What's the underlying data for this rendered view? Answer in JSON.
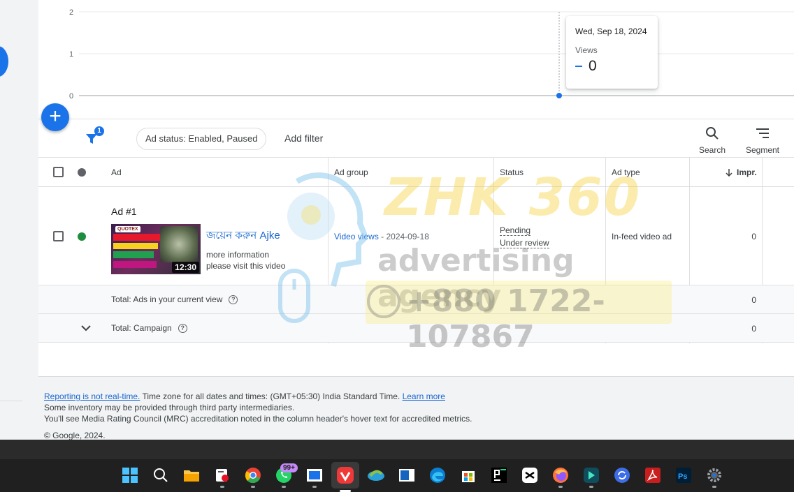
{
  "chart": {
    "y_ticks": [
      "2",
      "1",
      "0"
    ],
    "tooltip": {
      "date": "Wed, Sep 18, 2024",
      "metric": "Views",
      "value": "0",
      "series_color": "#1a73e8"
    }
  },
  "chart_data": {
    "type": "line",
    "x": [
      "2024-09-18"
    ],
    "series": [
      {
        "name": "Views",
        "values": [
          0
        ]
      }
    ],
    "ylim": [
      0,
      2
    ],
    "y_ticks": [
      0,
      1,
      2
    ],
    "grid": true
  },
  "fab": {
    "label": "+"
  },
  "filterbar": {
    "filter_count": "1",
    "chip": "Ad status: Enabled, Paused",
    "add_filter": "Add filter",
    "search": "Search",
    "segment": "Segment"
  },
  "table": {
    "columns": {
      "ad": "Ad",
      "ad_group": "Ad group",
      "status": "Status",
      "ad_type": "Ad type",
      "impr": "Impr."
    },
    "row": {
      "label": "Ad #1",
      "thumb_logo": "QUOTEX",
      "duration": "12:30",
      "headline": "জয়েন করুন Ajke",
      "desc_line1": "more information",
      "desc_line2": "please visit this video",
      "ad_group": "Video views",
      "ad_group_date": " - 2024-09-18",
      "status_line1": "Pending",
      "status_line2": "Under review",
      "ad_type": "In-feed video ad",
      "impr": "0",
      "status_color": "#1e8e3e"
    },
    "total_view": {
      "label": "Total: Ads in your current view",
      "impr": "0"
    },
    "total_campaign": {
      "label": "Total: Campaign",
      "impr": "0"
    }
  },
  "watermark": {
    "brand": "ZHK 360",
    "tagline": "advertising agency",
    "phone": "+880 1722-107867"
  },
  "footer": {
    "reporting_link": "Reporting is not real-time.",
    "timezone": " Time zone for all dates and times: (GMT+05:30) India Standard Time. ",
    "learn_more": "Learn more",
    "line2": "Some inventory may be provided through third party intermediaries.",
    "line3": "You'll see Media Rating Council (MRC) accreditation noted in the column header's hover text for accredited metrics.",
    "copyright": "© Google, 2024."
  },
  "taskbar": {
    "whatsapp_badge": "99+",
    "accent": "#1a73e8"
  }
}
